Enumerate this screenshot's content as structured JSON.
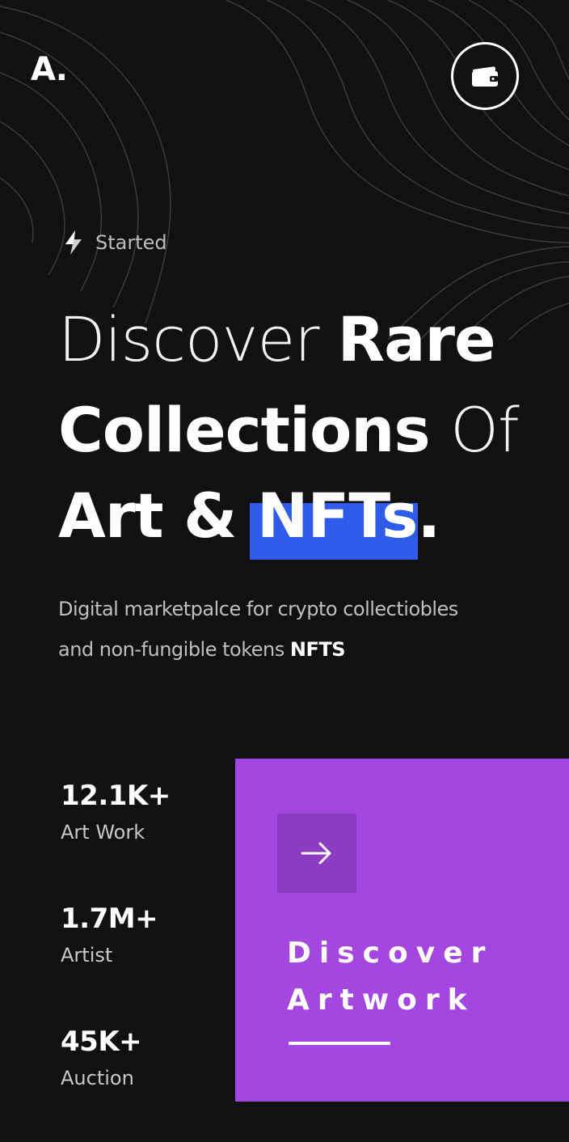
{
  "brand": {
    "logo": "A."
  },
  "header": {
    "wallet_icon": "wallet-icon"
  },
  "eyebrow": {
    "icon": "lightning-icon",
    "label": "Started"
  },
  "headline": {
    "line1_thin": "Discover ",
    "line1_bold": "Rare",
    "line2_bold": "Collections ",
    "line2_thin": "Of",
    "line3_bold": "Art & NFTs."
  },
  "description": {
    "line1": "Digital marketpalce for crypto collectiobles",
    "line2": "and non-fungible tokens ",
    "line2_bold": "NFTS"
  },
  "stats": [
    {
      "value": "12.1K+",
      "label": "Art Work"
    },
    {
      "value": "1.7M+",
      "label": "Artist"
    },
    {
      "value": "45K+",
      "label": "Auction"
    }
  ],
  "cta": {
    "icon": "arrow-right-icon",
    "line1": "Discover",
    "line2": "Artwork"
  },
  "colors": {
    "background": "#111113",
    "highlight": "#2f5bea",
    "cta_background": "#a347e0",
    "cta_icon_box": "#8b3cc0"
  }
}
